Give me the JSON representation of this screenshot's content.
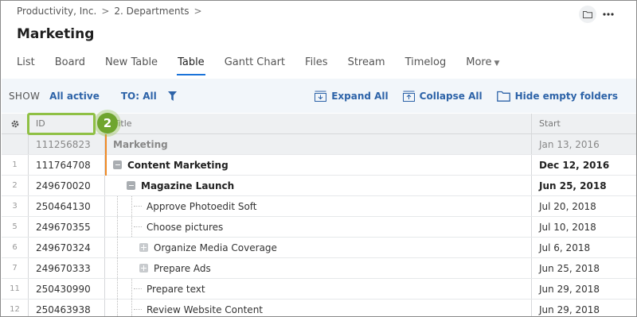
{
  "breadcrumb": {
    "root": "Productivity, Inc.",
    "sep": ">",
    "folder": "2. Departments",
    "sep2": ">"
  },
  "page_title": "Marketing",
  "tabs": [
    {
      "label": "List"
    },
    {
      "label": "Board"
    },
    {
      "label": "New Table"
    },
    {
      "label": "Table"
    },
    {
      "label": "Gantt Chart"
    },
    {
      "label": "Files"
    },
    {
      "label": "Stream"
    },
    {
      "label": "Timelog"
    },
    {
      "label": "More"
    }
  ],
  "toolbar": {
    "show_label": "SHOW",
    "show_value": "All active",
    "to_label": "TO: All",
    "expand_all": "Expand All",
    "collapse_all": "Collapse All",
    "hide_empty": "Hide empty folders"
  },
  "columns": {
    "id": "ID",
    "title": "Title",
    "start": "Start"
  },
  "rows": [
    {
      "num": "",
      "id": "111256823",
      "title": "Marketing",
      "start": "Jan 13, 2016"
    },
    {
      "num": "1",
      "id": "111764708",
      "title": "Content Marketing",
      "start": "Dec 12, 2016"
    },
    {
      "num": "2",
      "id": "249670020",
      "title": "Magazine Launch",
      "start": "Jun 25, 2018"
    },
    {
      "num": "3",
      "id": "250464130",
      "title": "Approve Photoedit Soft",
      "start": "Jul 20, 2018"
    },
    {
      "num": "5",
      "id": "249670355",
      "title": "Choose pictures",
      "start": "Jul 10, 2018"
    },
    {
      "num": "6",
      "id": "249670324",
      "title": "Organize Media Coverage",
      "start": "Jul 6, 2018"
    },
    {
      "num": "7",
      "id": "249670333",
      "title": "Prepare Ads",
      "start": "Jun 25, 2018"
    },
    {
      "num": "11",
      "id": "250430990",
      "title": "Prepare text",
      "start": "Jun 29, 2018"
    },
    {
      "num": "12",
      "id": "250463938",
      "title": "Review Website Content",
      "start": "Jun 29, 2018"
    }
  ],
  "step_badge": "2",
  "colors": {
    "accent": "#1a73d9",
    "link": "#2d63a8",
    "highlight": "#8fc045",
    "orange": "#f08a24"
  }
}
